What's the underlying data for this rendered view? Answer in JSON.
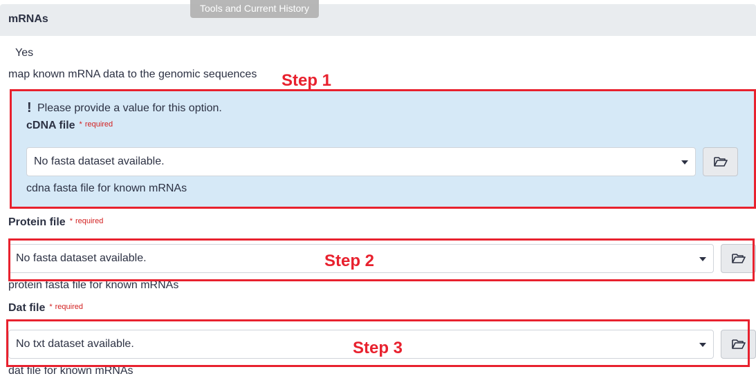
{
  "tooltip": "Tools and Current History",
  "section": {
    "title": "mRNAs"
  },
  "option": {
    "value": "Yes",
    "description": "map known mRNA data to the genomic sequences"
  },
  "alert": {
    "message": "Please provide a value for this option."
  },
  "cdna": {
    "label": "cDNA file",
    "required_mark": "*",
    "required_text": "required",
    "select_value": "No fasta dataset available.",
    "help": "cdna fasta file for known mRNAs"
  },
  "protein": {
    "label": "Protein file",
    "required_mark": "*",
    "required_text": "required",
    "select_value": "No fasta dataset available.",
    "help": "protein fasta file for known mRNAs"
  },
  "dat": {
    "label": "Dat file",
    "required_mark": "*",
    "required_text": "required",
    "select_value": "No txt dataset available.",
    "help": "dat file for known mRNAs"
  },
  "annotations": {
    "step1": "Step 1",
    "step2": "Step 2",
    "step3": "Step 3"
  },
  "colors": {
    "annotation": "#e8212e",
    "alert_bg": "#d6e9f7",
    "required": "#d21f1f",
    "header_bg": "#e9ecef"
  },
  "icons": {
    "browse": "folder-open-icon",
    "dropdown": "caret-down-icon",
    "alert": "exclamation-icon"
  }
}
